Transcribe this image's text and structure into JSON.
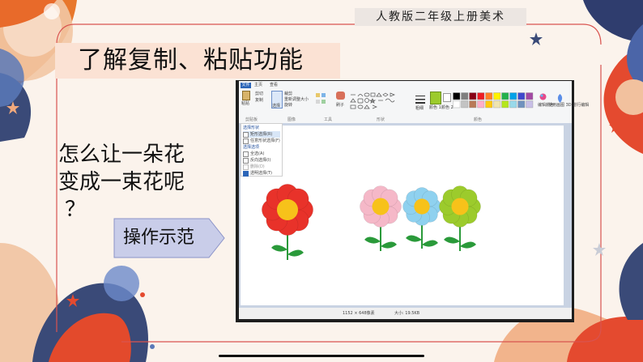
{
  "header": {
    "label": "人教版二年级上册美术"
  },
  "slide": {
    "title": "了解复制、粘贴功能",
    "question_lines": [
      "怎么让一朵花",
      "变成一束花呢",
      "？"
    ],
    "demo_button": "操作示范"
  },
  "paint": {
    "tabs": [
      "文件",
      "主页",
      "查看"
    ],
    "groups": [
      "剪贴板",
      "图像",
      "工具",
      "形状",
      "颜色"
    ],
    "ribbon": {
      "paste": "粘贴",
      "cut": "剪切",
      "copy": "复制",
      "select": "选择",
      "crop": "裁剪",
      "resize": "重新调整大小",
      "rotate": "旋转",
      "brush": "刷子",
      "size": "粗细",
      "color1": "颜色 1",
      "color2": "颜色 2",
      "edit_colors": "编辑颜色",
      "paint3d": "使用画图 3D 进行编辑"
    },
    "select_menu": {
      "section1": "选择形状",
      "items1": [
        "矩形选择(R)",
        "任意形状选择(F)"
      ],
      "section2": "选择选项",
      "items2": [
        "全选(A)",
        "反向选择(I)",
        "删除(D)",
        "透明选择(T)"
      ]
    },
    "status": {
      "dimensions": "1152 × 648像素",
      "filesize": "大小: 19.5KB"
    },
    "palette": [
      "#000000",
      "#7f7f7f",
      "#880015",
      "#ed1c24",
      "#ff7f27",
      "#fff200",
      "#22b14c",
      "#00a2e8",
      "#3f48cc",
      "#a349a4",
      "#ffffff",
      "#c3c3c3",
      "#b97a57",
      "#ffaec9",
      "#ffc90e",
      "#efe4b0",
      "#b5e61d",
      "#99d9ea",
      "#7092be",
      "#c8bfe7"
    ]
  },
  "flowers": [
    {
      "color": "#e8322a"
    },
    {
      "color": "#f5b8c8"
    },
    {
      "color": "#8fd1ef"
    },
    {
      "color": "#9ccb2c"
    }
  ]
}
